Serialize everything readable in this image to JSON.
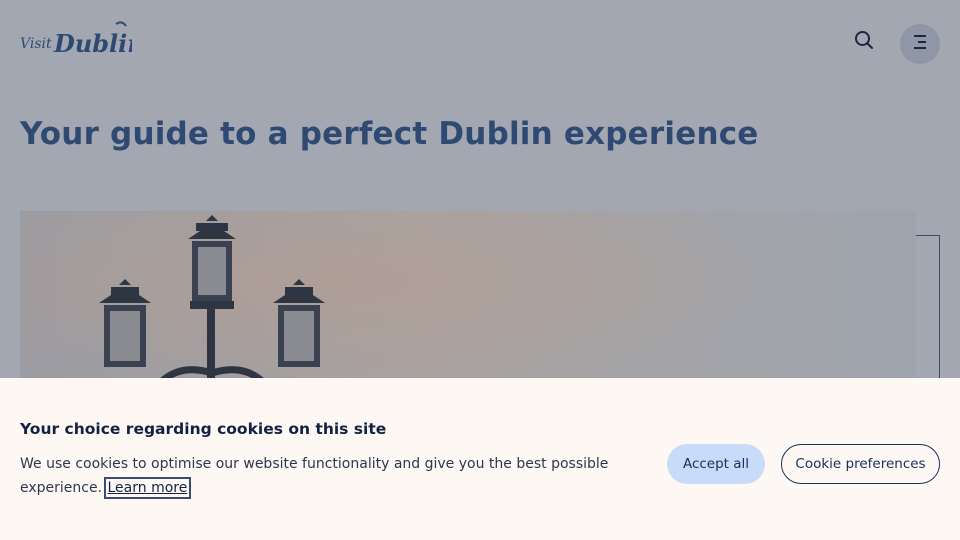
{
  "header": {
    "logo_text": "Visit Dublin",
    "search_icon": "search-icon",
    "menu_icon": "menu-icon"
  },
  "main": {
    "title": "Your guide to a perfect Dublin experience",
    "hero_image": "lamp-post-sky"
  },
  "cookie_banner": {
    "title": "Your choice regarding cookies on this site",
    "text": "We use cookies to optimise our website functionality and give you the best possible experience.",
    "learn_more": "Learn more",
    "accept_label": "Accept all",
    "preferences_label": "Cookie preferences"
  },
  "colors": {
    "overlay": "#a3a7b1",
    "title": "#2f4a72",
    "banner_bg": "#fef8f4",
    "accept_bg": "#c8dcf9",
    "accent": "#17305c"
  }
}
